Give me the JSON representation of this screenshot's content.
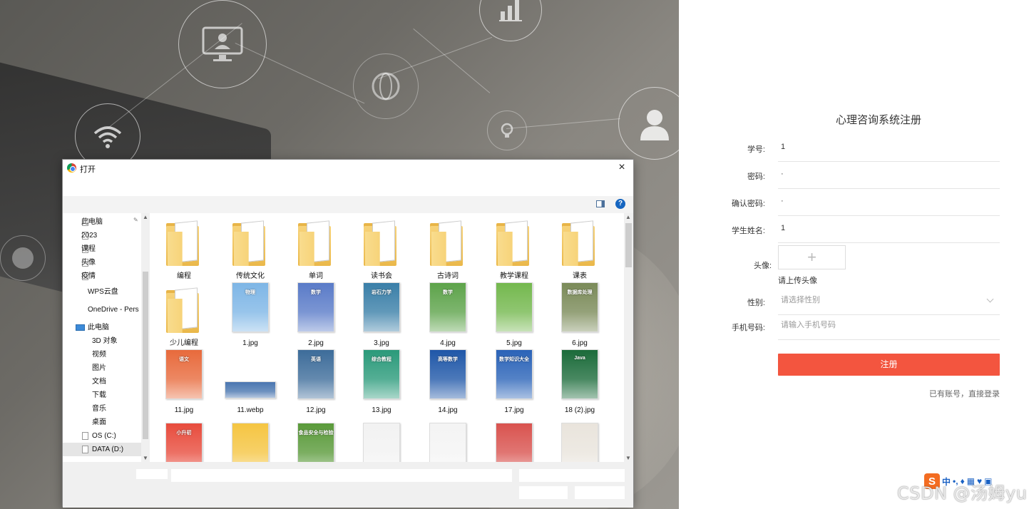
{
  "form": {
    "title": "心理咨询系统注册",
    "fields": {
      "student_id": {
        "label": "学号:",
        "value": "1"
      },
      "password": {
        "label": "密码:",
        "value": "·"
      },
      "confirm_password": {
        "label": "确认密码:",
        "value": "·"
      },
      "student_name": {
        "label": "学生姓名:",
        "value": "1"
      },
      "gender": {
        "label": "性别:",
        "placeholder": "请选择性别"
      },
      "phone": {
        "label": "手机号码:",
        "placeholder": "请输入手机号码"
      }
    },
    "avatar": {
      "label": "头像:",
      "plus": "+",
      "hint": "请上传头像"
    },
    "submit_label": "注册",
    "login_link": "已有账号，直接登录",
    "accent_color": "#f3553f"
  },
  "dialog": {
    "title": "打开",
    "close": "×",
    "help": "?",
    "nav": {
      "quick_access": [
        "此电脑",
        "2023",
        "课程",
        "头像",
        "疫情"
      ],
      "wps": "WPS云盘",
      "onedrive": "OneDrive - Pers",
      "this_pc": "此电脑",
      "pc_items": [
        "3D 对象",
        "视频",
        "图片",
        "文档",
        "下载",
        "音乐",
        "桌面",
        "OS (C:)",
        "DATA (D:)"
      ]
    },
    "files": [
      {
        "name": "编程",
        "kind": "folder"
      },
      {
        "name": "传统文化",
        "kind": "folder"
      },
      {
        "name": "单词",
        "kind": "folder"
      },
      {
        "name": "读书会",
        "kind": "folder"
      },
      {
        "name": "古诗词",
        "kind": "folder"
      },
      {
        "name": "教学课程",
        "kind": "folder"
      },
      {
        "name": "课表",
        "kind": "folder"
      },
      {
        "name": "少儿编程",
        "kind": "folder"
      },
      {
        "name": "1.jpg",
        "kind": "image",
        "color": "#7eb6e6",
        "text": "物理"
      },
      {
        "name": "2.jpg",
        "kind": "image",
        "color": "#5a7bc8",
        "text": "数学"
      },
      {
        "name": "3.jpg",
        "kind": "image",
        "color": "#3a7fa8",
        "text": "岩石力学"
      },
      {
        "name": "4.jpg",
        "kind": "image",
        "color": "#5da34a",
        "text": "数学"
      },
      {
        "name": "5.jpg",
        "kind": "image",
        "color": "#74b84e",
        "text": ""
      },
      {
        "name": "6.jpg",
        "kind": "image",
        "color": "#7a8a58",
        "text": "数据库处理"
      },
      {
        "name": "11.jpg",
        "kind": "image",
        "color": "#e86a3c",
        "text": "语文"
      },
      {
        "name": "11.webp",
        "kind": "image",
        "color": "#4a76b0",
        "text": ""
      },
      {
        "name": "12.jpg",
        "kind": "image",
        "color": "#3d6c9a",
        "text": "英语"
      },
      {
        "name": "13.jpg",
        "kind": "image",
        "color": "#2a9a7a",
        "text": "综合教程"
      },
      {
        "name": "14.jpg",
        "kind": "image",
        "color": "#1f57a8",
        "text": "高等数学"
      },
      {
        "name": "17.jpg",
        "kind": "image",
        "color": "#2a63b8",
        "text": "数学知识大全"
      },
      {
        "name": "18 (2).jpg",
        "kind": "image",
        "color": "#1b6b3a",
        "text": "Java"
      },
      {
        "name": "",
        "kind": "image",
        "color": "#e84c3d",
        "text": "小升初"
      },
      {
        "name": "",
        "kind": "image",
        "color": "#f5c542",
        "text": ""
      },
      {
        "name": "",
        "kind": "image",
        "color": "#5a9a3a",
        "text": "食品安全与检验"
      },
      {
        "name": "",
        "kind": "image",
        "color": "#f2f2f2",
        "text": ""
      },
      {
        "name": "",
        "kind": "image",
        "color": "#f4f4f4",
        "text": ""
      },
      {
        "name": "",
        "kind": "image",
        "color": "#d9534f",
        "text": ""
      },
      {
        "name": "",
        "kind": "image",
        "color": "#e9e4dc",
        "text": ""
      }
    ]
  },
  "watermark": "CSDN @汤姆yu",
  "ime": {
    "logo": "S",
    "mode": "中"
  }
}
